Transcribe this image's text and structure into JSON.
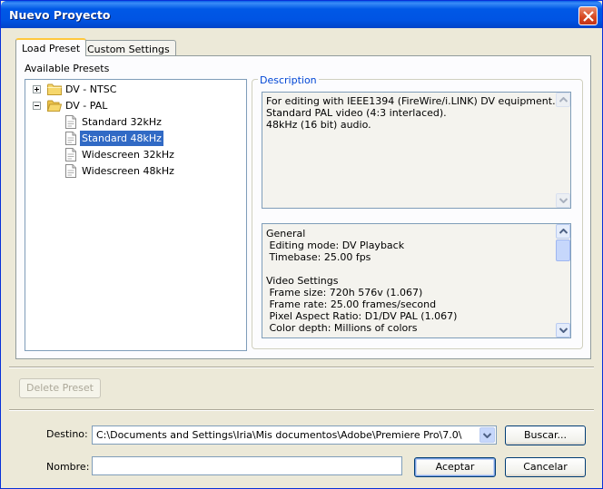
{
  "window": {
    "title": "Nuevo Proyecto"
  },
  "tabs": [
    {
      "label": "Load Preset",
      "active": true
    },
    {
      "label": "Custom Settings",
      "active": false
    }
  ],
  "presets": {
    "label": "Available Presets",
    "tree": [
      {
        "label": "DV - NTSC",
        "type": "folder",
        "expanded": false
      },
      {
        "label": "DV - PAL",
        "type": "folder",
        "expanded": true
      },
      {
        "label": "Standard 32kHz",
        "type": "preset"
      },
      {
        "label": "Standard 48kHz",
        "type": "preset",
        "selected": true
      },
      {
        "label": "Widescreen 32kHz",
        "type": "preset"
      },
      {
        "label": "Widescreen 48kHz",
        "type": "preset"
      }
    ]
  },
  "description": {
    "label": "Description",
    "text": "For editing with IEEE1394 (FireWire/i.LINK) DV equipment.\nStandard PAL video (4:3 interlaced).\n48kHz (16 bit) audio.",
    "details": "General\n Editing mode: DV Playback\n Timebase: 25.00 fps\n\nVideo Settings\n Frame size: 720h 576v (1.067)\n Frame rate: 25.00 frames/second\n Pixel Aspect Ratio: D1/DV PAL (1.067)\n Color depth: Millions of colors"
  },
  "buttons": {
    "delete_preset": "Delete Preset",
    "browse": "Buscar...",
    "ok": "Aceptar",
    "cancel": "Cancelar"
  },
  "location": {
    "label": "Destino:",
    "value": "C:\\Documents and Settings\\Iria\\Mis documentos\\Adobe\\Premiere Pro\\7.0\\"
  },
  "name": {
    "label": "Nombre:",
    "value": ""
  },
  "colors": {
    "titlebar": "#0054e3",
    "selection": "#316ac5",
    "group_label": "#0046d5"
  }
}
